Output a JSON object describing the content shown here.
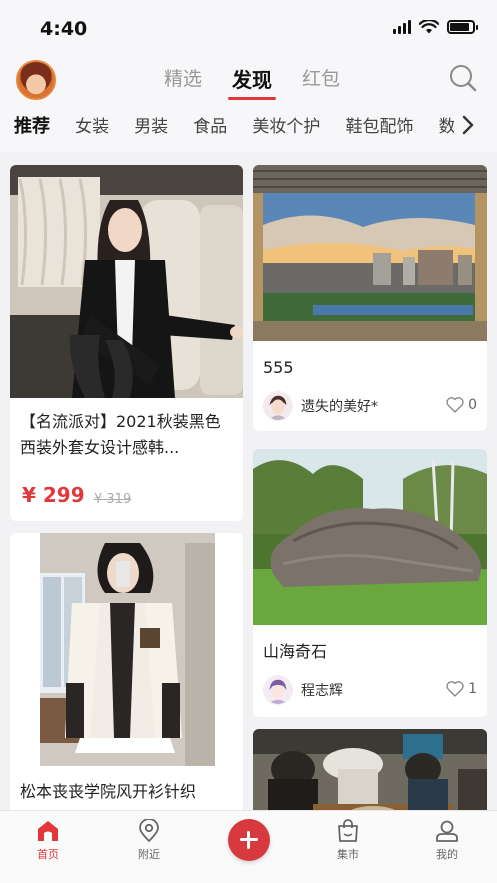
{
  "status": {
    "time": "4:40",
    "battery_level": 0.85
  },
  "header": {
    "tabs": [
      {
        "label": "精选"
      },
      {
        "label": "发现"
      },
      {
        "label": "红包"
      }
    ],
    "active_tab": "发现",
    "categories": [
      "推荐",
      "女装",
      "男装",
      "食品",
      "美妆个护",
      "鞋包配饰",
      "数"
    ],
    "active_category": "推荐"
  },
  "feed": {
    "left": [
      {
        "type": "product",
        "title": "【名流派对】2021秋装黑色西装外套女设计感韩...",
        "price": "¥ 299",
        "price_old": "¥ 319",
        "image_icon": "woman-black-blazer-photo"
      },
      {
        "type": "product",
        "title": "松本丧丧学院风开衫针织",
        "image_icon": "woman-cardigan-selfie-photo"
      }
    ],
    "right": [
      {
        "type": "post",
        "title": "555",
        "author": "遗失的美好*",
        "likes": "0",
        "image_icon": "city-view-photo"
      },
      {
        "type": "post",
        "title": "山海奇石",
        "author": "程志辉",
        "likes": "1",
        "image_icon": "rock-garden-photo"
      },
      {
        "type": "post",
        "image_icon": "restaurant-photo"
      }
    ]
  },
  "bottom_nav": {
    "items": [
      {
        "label": "首页",
        "icon": "home-icon"
      },
      {
        "label": "附近",
        "icon": "location-icon"
      },
      {
        "label": "集市",
        "icon": "shopping-bag-icon"
      },
      {
        "label": "我的",
        "icon": "user-icon"
      }
    ],
    "active": "首页"
  },
  "colors": {
    "accent": "#e0383b",
    "background": "#f2f2f4"
  }
}
